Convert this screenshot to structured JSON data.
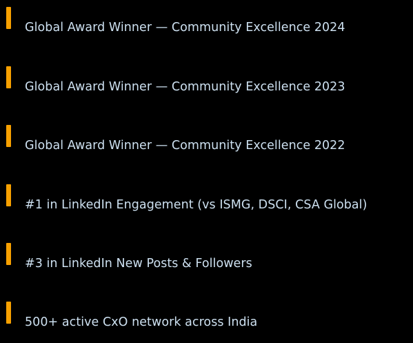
{
  "accent_color": "#f7a000",
  "text_color": "#cde0f0",
  "background_color": "#000000",
  "highlights": [
    {
      "icon": "orange-bar-icon",
      "label": "Global Award Winner — Community Excellence 2024"
    },
    {
      "icon": "orange-bar-icon",
      "label": "Global Award Winner — Community Excellence 2023"
    },
    {
      "icon": "orange-bar-icon",
      "label": "Global Award Winner — Community Excellence 2022"
    },
    {
      "icon": "orange-bar-icon",
      "label": "#1 in LinkedIn Engagement (vs ISMG, DSCI, CSA Global)"
    },
    {
      "icon": "orange-bar-icon",
      "label": "#3 in LinkedIn New Posts & Followers"
    },
    {
      "icon": "orange-bar-icon",
      "label": "500+ active CxO network across India"
    }
  ]
}
